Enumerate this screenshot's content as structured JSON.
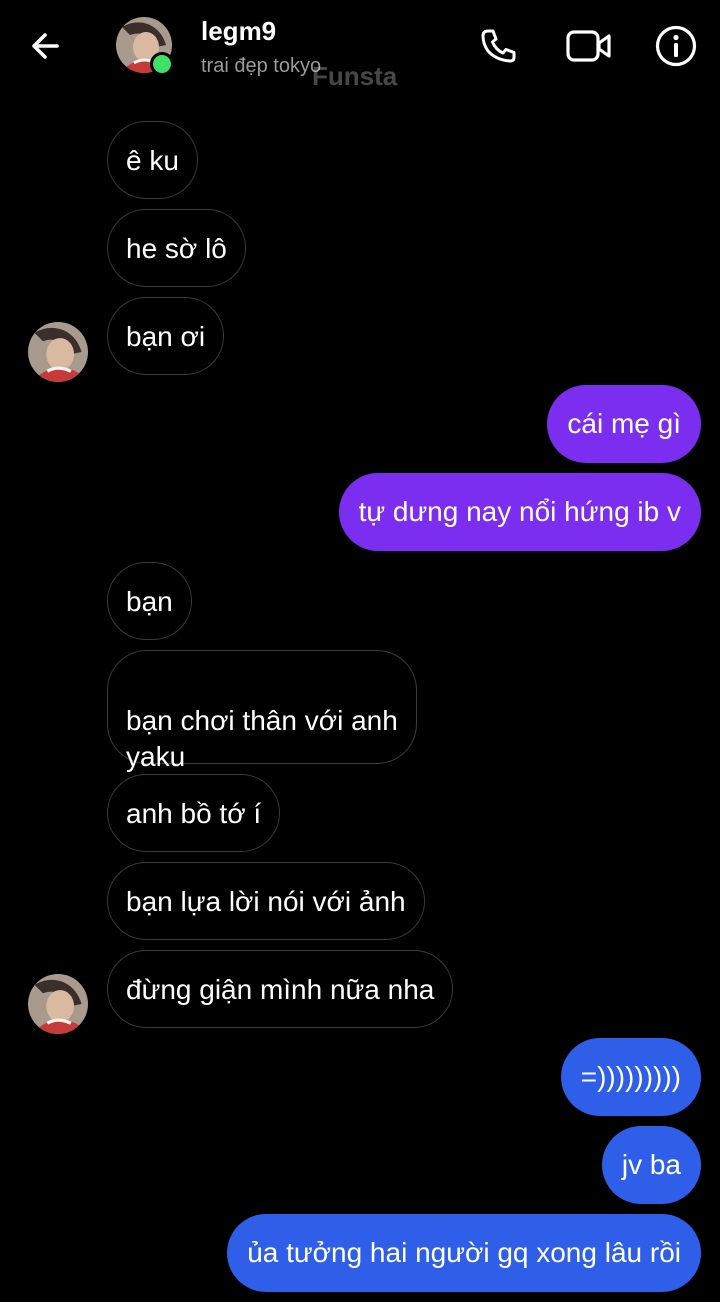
{
  "header": {
    "back_icon": "arrow-left-icon",
    "username": "legm9",
    "subtitle": "trai đẹp tokyo",
    "watermark": "Funsta",
    "avatar": "profile-avatar",
    "online_status_color": "#3ee06a",
    "actions": [
      {
        "icon": "phone-icon",
        "action": "voice call"
      },
      {
        "icon": "video-camera-icon",
        "action": "video call"
      },
      {
        "icon": "info-icon",
        "action": "conversation info"
      }
    ]
  },
  "colors": {
    "background": "#000000",
    "received_border": "#3a3a3a",
    "sent_purple": "#7c2ef0",
    "sent_blue": "#2f5fe8"
  },
  "messages": [
    {
      "from": "them",
      "text": "ê ku"
    },
    {
      "from": "them",
      "text": "he sờ lô"
    },
    {
      "from": "them",
      "text": "bạn ơi"
    },
    {
      "from": "me",
      "text": "cái mẹ gì"
    },
    {
      "from": "me",
      "text": "tự dưng nay nổi hứng ib v"
    },
    {
      "from": "them",
      "text": "bạn"
    },
    {
      "from": "them",
      "text": "bạn chơi thân với anh\nyaku"
    },
    {
      "from": "them",
      "text": "anh bồ tớ í"
    },
    {
      "from": "them",
      "text": "bạn lựa lời nói với ảnh"
    },
    {
      "from": "them",
      "text": "đừng giận mình nữa nha"
    },
    {
      "from": "me",
      "text": "=)))))))))"
    },
    {
      "from": "me",
      "text": "jv ba"
    },
    {
      "from": "me",
      "text": "ủa tưởng hai người gq xong lâu rồi"
    }
  ]
}
